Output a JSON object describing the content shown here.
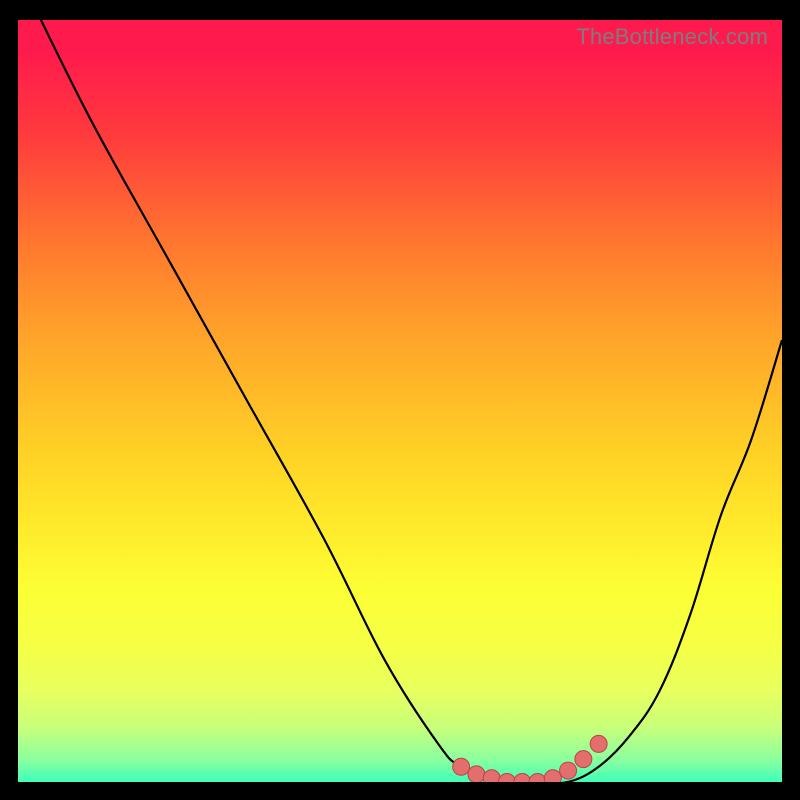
{
  "watermark": "TheBottleneck.com",
  "palette": {
    "frame": "#000000",
    "curve": "#000000",
    "marker_fill": "#e26f6e",
    "marker_stroke": "#c24043"
  },
  "chart_data": {
    "type": "line",
    "title": "",
    "xlabel": "",
    "ylabel": "",
    "xlim": [
      0,
      100
    ],
    "ylim": [
      0,
      100
    ],
    "series": [
      {
        "name": "bottleneck-curve",
        "x": [
          3,
          10,
          20,
          30,
          40,
          48,
          55,
          58,
          63,
          68,
          72,
          76,
          80,
          84,
          88,
          92,
          96,
          100
        ],
        "y": [
          100,
          86,
          68,
          50,
          32,
          16,
          5,
          2,
          0,
          0,
          0,
          2,
          6,
          12,
          22,
          35,
          45,
          58
        ]
      }
    ],
    "markers": [
      {
        "name": "flat-region-left-end",
        "x": 58,
        "y": 2
      },
      {
        "name": "flat-region-1",
        "x": 60,
        "y": 1
      },
      {
        "name": "flat-region-2",
        "x": 62,
        "y": 0.5
      },
      {
        "name": "flat-region-3",
        "x": 64,
        "y": 0
      },
      {
        "name": "flat-region-4",
        "x": 66,
        "y": 0
      },
      {
        "name": "flat-region-5",
        "x": 68,
        "y": 0
      },
      {
        "name": "flat-region-6",
        "x": 70,
        "y": 0.5
      },
      {
        "name": "flat-region-7",
        "x": 72,
        "y": 1.5
      },
      {
        "name": "flat-region-right-1",
        "x": 74,
        "y": 3
      },
      {
        "name": "flat-region-right-end",
        "x": 76,
        "y": 5
      }
    ]
  }
}
